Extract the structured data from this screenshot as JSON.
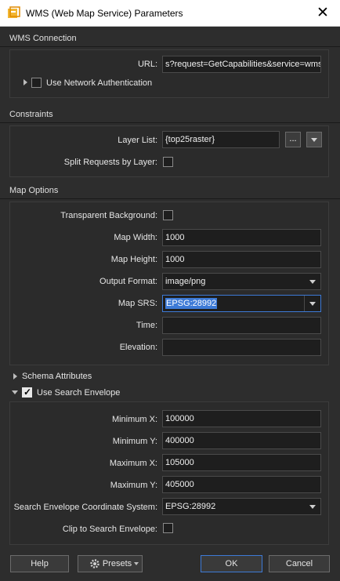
{
  "window": {
    "title": "WMS (Web Map Service) Parameters",
    "close_glyph": "✕"
  },
  "wms_connection": {
    "header": "WMS Connection",
    "url_label": "URL:",
    "url_value": "s?request=GetCapabilities&service=wms",
    "network_auth_label": "Use Network Authentication",
    "network_auth_checked": false
  },
  "constraints": {
    "header": "Constraints",
    "layer_list_label": "Layer List:",
    "layer_list_value": "{top25raster}",
    "browse_label": "...",
    "split_label": "Split Requests by Layer:",
    "split_checked": false
  },
  "map_options": {
    "header": "Map Options",
    "transparent_label": "Transparent Background:",
    "transparent_checked": false,
    "width_label": "Map Width:",
    "width_value": "1000",
    "height_label": "Map Height:",
    "height_value": "1000",
    "format_label": "Output Format:",
    "format_value": "image/png",
    "srs_label": "Map SRS:",
    "srs_value": "EPSG:28992",
    "time_label": "Time:",
    "time_value": "",
    "elevation_label": "Elevation:",
    "elevation_value": ""
  },
  "schema_attributes": {
    "header": "Schema Attributes"
  },
  "search_envelope": {
    "header": "Use Search Envelope",
    "checked": true,
    "min_x_label": "Minimum X:",
    "min_x_value": "100000",
    "min_y_label": "Minimum Y:",
    "min_y_value": "400000",
    "max_x_label": "Maximum X:",
    "max_x_value": "105000",
    "max_y_label": "Maximum Y:",
    "max_y_value": "405000",
    "coord_sys_label": "Search Envelope Coordinate System:",
    "coord_sys_value": "EPSG:28992",
    "clip_label": "Clip to Search Envelope:",
    "clip_checked": false
  },
  "footer": {
    "help_label": "Help",
    "presets_label": "Presets",
    "ok_label": "OK",
    "cancel_label": "Cancel"
  },
  "colors": {
    "accent": "#3d7ad6",
    "background": "#2d2d2d",
    "field": "#1e1e1e"
  },
  "icons": [
    "app-icon",
    "close-icon",
    "expand-triangle-icon",
    "collapse-triangle-icon",
    "dropdown-arrow-icon",
    "checkmark-icon",
    "gear-icon"
  ]
}
